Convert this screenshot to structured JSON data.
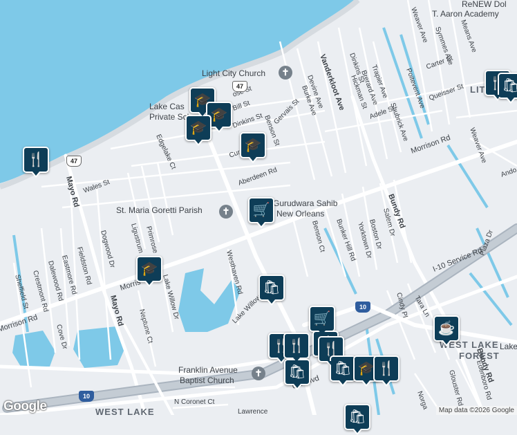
{
  "map": {
    "neighborhoods": {
      "little_woods": "LIT",
      "west_lake_forest_1": "WEST LAKE",
      "west_lake_forest_2": "FOREST",
      "west_lake_bottom": "WEST LAKE",
      "lake_top_right": "Lake"
    },
    "places": {
      "renew_1": "ReNEW Dol",
      "renew_2": "T. Aaron Academy",
      "light_city_church": "Light City Church",
      "lake_castle_1": "Lake Cas",
      "lake_castle_2": "Private Sch",
      "st_maria": "St. Maria Goretti Parish",
      "gurudwara_1": "Gurudwara Sahib",
      "gurudwara_2": "New Orleans",
      "franklin_1": "Franklin Avenue",
      "franklin_2": "Baptist Church"
    },
    "streets": {
      "vanderkloot": "Vanderkloot Ave",
      "dinkins": "Dinkins St",
      "trapier": "Trapier Ave",
      "brerard": "Brerard Ave",
      "hickman": "Hickman St",
      "devine": "Devine Ave",
      "burke": "Burke Ave",
      "weaver_top": "Weaver Ave",
      "symmes": "Symmes Ave",
      "means": "Means Ave",
      "poitevent": "Poitevent Ave",
      "carter": "Carter St",
      "quesser": "Queisser St",
      "shubrick": "Shubrick Ave",
      "adele": "Adele St",
      "morrison_east": "Morrison Rd",
      "weaver_right": "Weaver Ave",
      "andover": "Ando",
      "gervais": "Gervais St",
      "dinkins2": "Dinkins St",
      "bill": "Bill St",
      "ose": "ose St",
      "benson_top": "Benson St",
      "curran": "Curr",
      "aberdeen": "Aberdeen Rd",
      "edgelake": "Edgelake Ct",
      "wales": "Wales St",
      "mayo_top": "Mayo Rd",
      "mayo_bottom": "Mayo Rd",
      "fieldston": "Fieldston Rd",
      "eastmore": "Eastmore Rd",
      "dalewood": "Dalewood Rd",
      "crestmont": "Crestmont Rd",
      "sheffield": "Sheffield St",
      "dogwood": "Dogwood Dr",
      "ligustrum": "Ligustrum",
      "primrose": "Primrose",
      "lake_willow_dr": "Lake Willow Dr",
      "neptune": "Neptune Ct",
      "cove": "Cove Dr",
      "morrison_west": "Morrison Rd",
      "morrison_mid": "Morris",
      "westhaven": "Westhaven Rd",
      "lake_willow": "Lake Willow",
      "benson_ct": "Benson Ct",
      "bunker_hill": "Bunker Hill Rd",
      "yorktown": "Yorktown Dr",
      "boston": "Boston Dr",
      "salem": "Salem Dr",
      "bundy_top": "Bundy Rd",
      "bundy_bottom": "Bundy Rd",
      "i10_service": "I-10 Service Rd",
      "plaza": "Plaza Dr",
      "cindy": "Cindy Pl",
      "tara": "Tara Ln",
      "glouster": "Glouster Rd",
      "edenboro": "Edenboro Rd",
      "norgate": "Norga",
      "crowder": "der Blvd",
      "lake_forest_blvd": "La",
      "n_coronet": "N Coronet Ct",
      "lawrence": "Lawrence"
    },
    "route_shields": {
      "r47_top": "47",
      "r47_left": "47",
      "i10_a": "10",
      "i10_b": "10",
      "i10_c": "10"
    },
    "attribution": "Map data ©2026 Google",
    "logo": "Google"
  },
  "markers": [
    {
      "name": "school-marker",
      "icon": "graduation-cap-icon",
      "glyph": "🎓"
    },
    {
      "name": "school-marker",
      "icon": "graduation-cap-icon",
      "glyph": "🎓"
    },
    {
      "name": "school-marker",
      "icon": "graduation-cap-icon",
      "glyph": "🎓"
    },
    {
      "name": "school-marker",
      "icon": "graduation-cap-icon",
      "glyph": "🎓"
    },
    {
      "name": "restaurant-marker",
      "icon": "fork-knife-icon",
      "glyph": "🍴"
    },
    {
      "name": "grocery-marker",
      "icon": "shopping-cart-icon",
      "glyph": "🛒"
    },
    {
      "name": "school-marker",
      "icon": "graduation-cap-icon",
      "glyph": "🎓"
    },
    {
      "name": "shopping-marker",
      "icon": "shopping-bag-icon",
      "glyph": "🛍"
    },
    {
      "name": "grocery-marker",
      "icon": "shopping-cart-icon",
      "glyph": "🛒"
    },
    {
      "name": "restaurant-marker",
      "icon": "fork-knife-icon",
      "glyph": "🍴"
    },
    {
      "name": "restaurant-marker",
      "icon": "fork-knife-icon",
      "glyph": "🍴"
    },
    {
      "name": "restaurant-marker",
      "icon": "fork-knife-icon",
      "glyph": "🍴"
    },
    {
      "name": "restaurant-marker",
      "icon": "fork-knife-icon",
      "glyph": "🍴"
    },
    {
      "name": "shopping-marker",
      "icon": "shopping-bag-icon",
      "glyph": "🛍"
    },
    {
      "name": "shopping-marker",
      "icon": "shopping-bag-icon",
      "glyph": "🛍"
    },
    {
      "name": "school-marker",
      "icon": "graduation-cap-icon",
      "glyph": "🎓"
    },
    {
      "name": "restaurant-marker",
      "icon": "fork-knife-icon",
      "glyph": "🍴"
    },
    {
      "name": "cafe-marker",
      "icon": "coffee-cup-icon",
      "glyph": "☕"
    },
    {
      "name": "restaurant-marker",
      "icon": "fork-knife-icon",
      "glyph": "🍴"
    },
    {
      "name": "shopping-marker",
      "icon": "shopping-bag-icon",
      "glyph": "🛍"
    },
    {
      "name": "shopping-marker",
      "icon": "shopping-bag-icon",
      "glyph": "🛍"
    }
  ],
  "colors": {
    "water": "#7ec9e8",
    "land": "#ebeef2",
    "highway": "#aab4bf",
    "marker": "#0e3d57"
  }
}
